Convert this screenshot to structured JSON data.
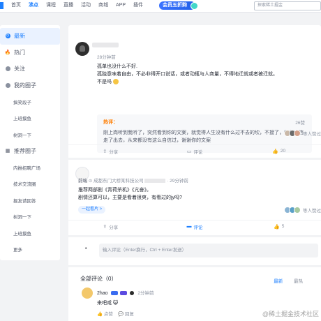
{
  "nav": {
    "items": [
      {
        "label": "首页",
        "active": false
      },
      {
        "label": "沸点",
        "active": true
      },
      {
        "label": "课程",
        "active": false
      },
      {
        "label": "直播",
        "active": false
      },
      {
        "label": "活动",
        "active": false
      },
      {
        "label": "商城",
        "active": false
      },
      {
        "label": "APP",
        "active": false
      },
      {
        "label": "插件",
        "active": false
      }
    ],
    "vip_label": "会员五折购",
    "search_placeholder": "探索稀土掘金"
  },
  "sidebar": {
    "latest": "最新",
    "hot": "热门",
    "follow": "关注",
    "my_circles": "我的圈子",
    "my_circle_items": [
      "搞笑段子",
      "上班摸鱼",
      "树洞一下"
    ],
    "recommended": "推荐圈子",
    "recommended_items": [
      "内推招聘广场",
      "技术交流圈",
      "掘友请回答",
      "树洞一下",
      "上班摸鱼",
      "更多"
    ]
  },
  "post1": {
    "time": "28分钟前",
    "lines": [
      "孤单也没什么不好.",
      "孤独意味着自由，不必非得开口说话，或者动辄与人商量，不得地迁就或者被迁就。",
      "不是吗"
    ],
    "hot_label": "热评：",
    "hot_likes": "26赞",
    "hot_text": "刚上岗听到我听了，突然看到你的文案，就觉得人生没有什么过不去的坎，不接了，怀着自信走了出去，从来都没有这么自信过，谢谢你的文案",
    "liked_text": "等人赞过",
    "share": "分享",
    "comment": "评论",
    "likes": "20"
  },
  "post2": {
    "name": "前端",
    "company": "成都东门大桥某科技公司",
    "time": "· 29分钟前",
    "line1": "推荐两部剧《青荷杀机》《亢奋》。",
    "line2": "剧情还算可以，主要是看着很爽，有看过的jy吗?",
    "circle": "一起看片 >",
    "liked_text": "等人赞过",
    "share": "分享",
    "comment": "评论",
    "likes": "5"
  },
  "comment_box": {
    "placeholder": "输入评论（Enter换行，Ctrl + Enter发送）"
  },
  "comments": {
    "title": "全部评论（0）",
    "tab_latest": "最新",
    "tab_hot": "最热",
    "items": [
      {
        "name": "2hao",
        "time": "2分钟前",
        "text": "来吧咸",
        "like": "点赞",
        "reply": "回复"
      }
    ],
    "watermark": "@稀土掘金技术社区"
  },
  "colors": {
    "accent": "#1e80ff",
    "hot": "#ff7d00"
  }
}
